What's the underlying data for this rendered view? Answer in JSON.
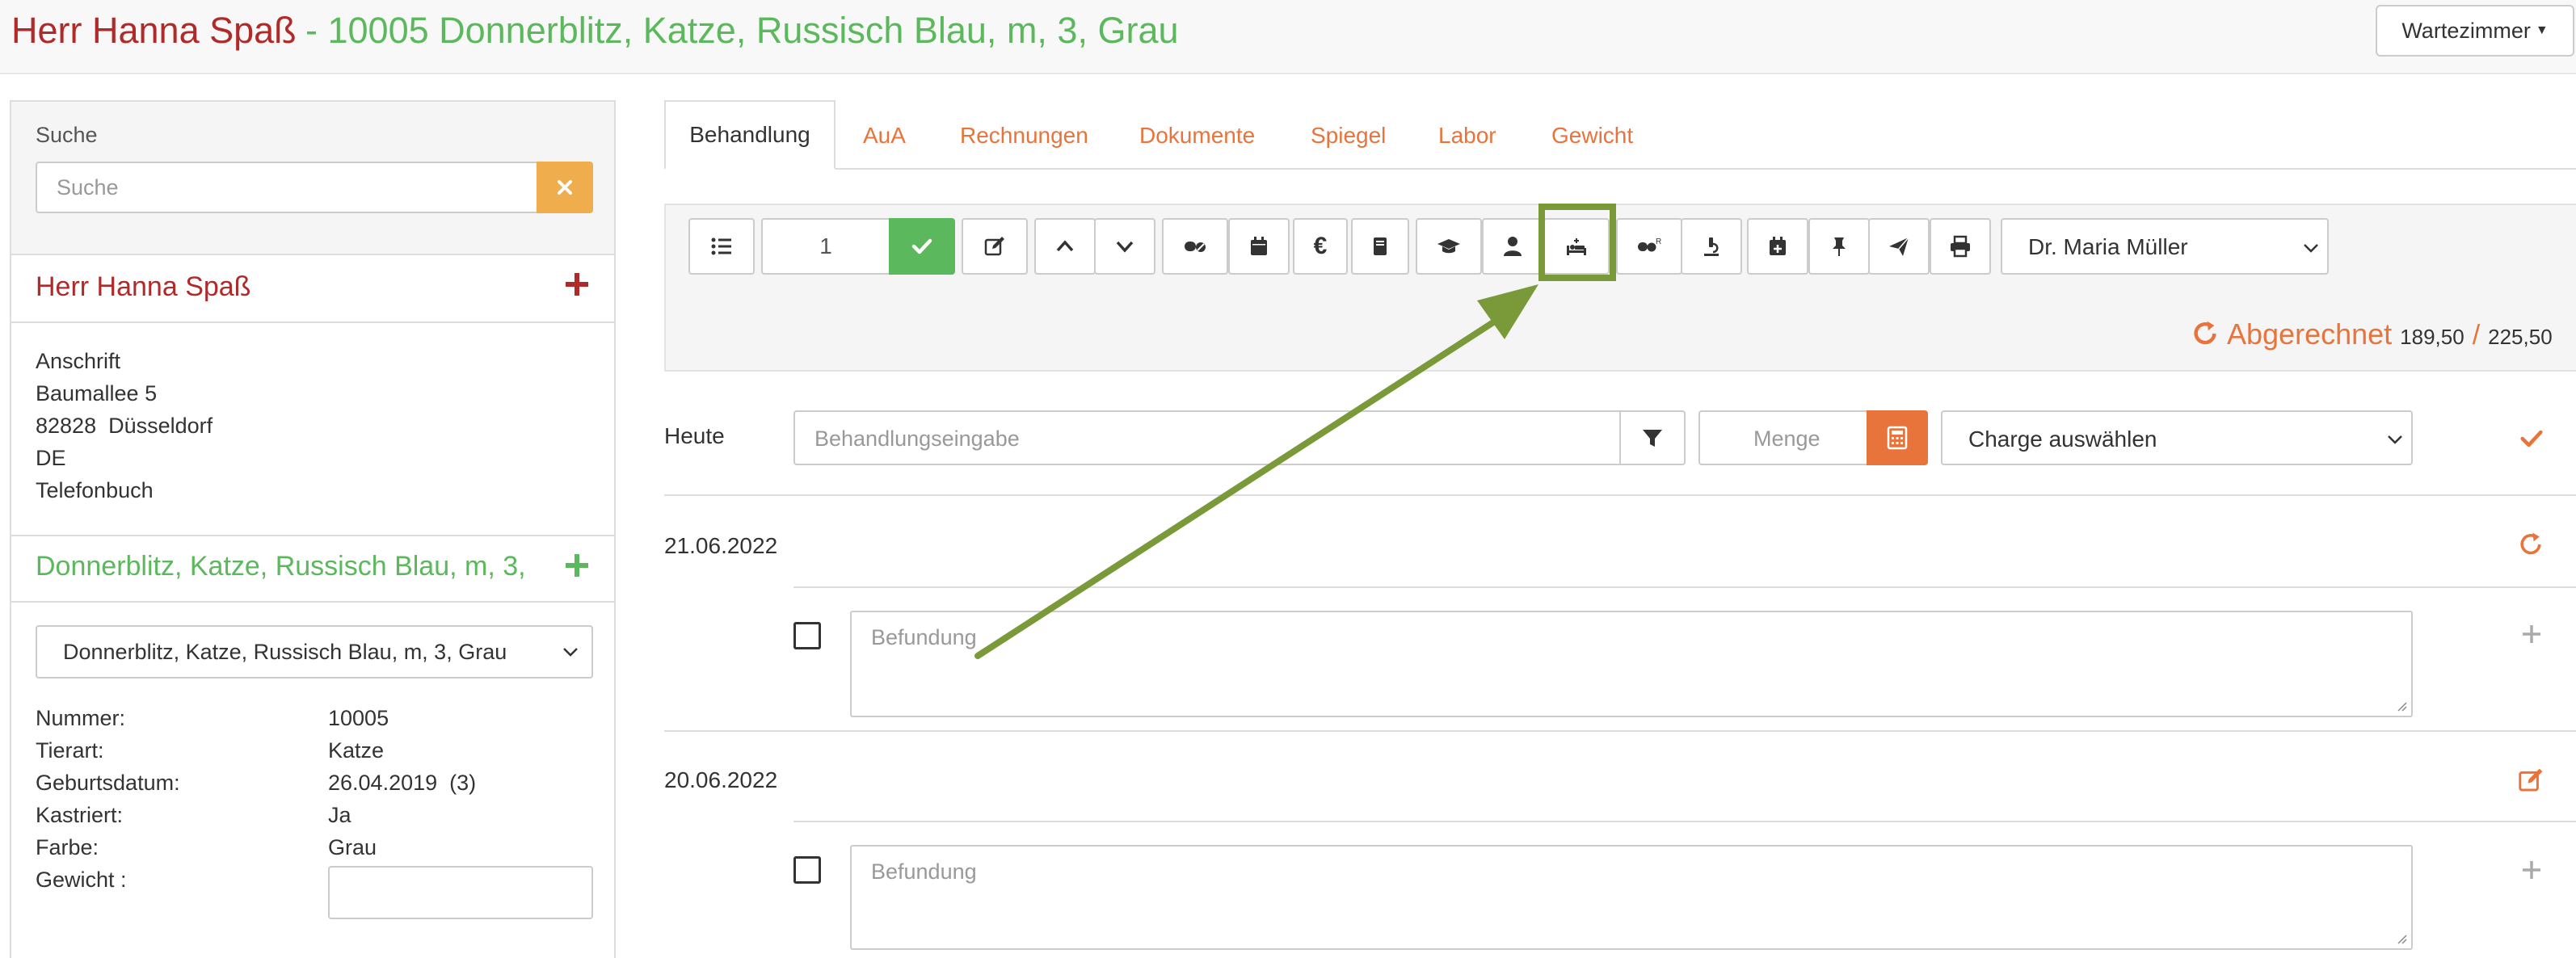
{
  "header": {
    "owner_name": "Herr Hanna Spaß",
    "patient_title": "- 10005 Donnerblitz, Katze, Russisch Blau, m, 3, Grau",
    "waiting_room_button": "Wartezimmer"
  },
  "sidebar": {
    "search_label": "Suche",
    "search_placeholder": "Suche",
    "owner_name": "Herr Hanna Spaß",
    "address": {
      "heading": "Anschrift",
      "street": "Baumallee 5",
      "city": "82828  Düsseldorf",
      "country": "DE",
      "phonebook": "Telefonbuch"
    },
    "patient_name": "Donnerblitz, Katze, Russisch Blau, m, 3,",
    "patient_select_value": "Donnerblitz, Katze, Russisch Blau, m, 3, Grau",
    "details": {
      "number_label": "Nummer:",
      "number_value": "10005",
      "species_label": "Tierart:",
      "species_value": "Katze",
      "birthdate_label": "Geburtsdatum:",
      "birthdate_value": "26.04.2019  (3)",
      "neutered_label": "Kastriert:",
      "neutered_value": "Ja",
      "color_label": "Farbe:",
      "color_value": "Grau",
      "weight_label": "Gewicht :",
      "weight_value": ""
    }
  },
  "tabs": [
    "Behandlung",
    "AuA",
    "Rechnungen",
    "Dokumente",
    "Spiegel",
    "Labor",
    "Gewicht"
  ],
  "toolbar": {
    "count_value": "1",
    "vet_select": "Dr. Maria Müller",
    "billing_label": "Abgerechnet",
    "billing_amount": "189,50",
    "billing_separator": "/",
    "billing_total": "225,50",
    "highlighted_icon": "hospital-bed-icon"
  },
  "entry": {
    "today_label": "Heute",
    "treatment_placeholder": "Behandlungseingabe",
    "quantity_placeholder": "Menge",
    "batch_select": "Charge auswählen"
  },
  "records": [
    {
      "date": "21.06.2022",
      "finding_placeholder": "Befundung",
      "action_icon": "refresh-icon"
    },
    {
      "date": "20.06.2022",
      "finding_placeholder": "Befundung",
      "action_icon": "edit-icon"
    }
  ],
  "colors": {
    "owner_red": "#b12a2a",
    "patient_green": "#5cb85c",
    "accent_orange": "#e8743b",
    "highlight_green": "#7a9a3a"
  }
}
